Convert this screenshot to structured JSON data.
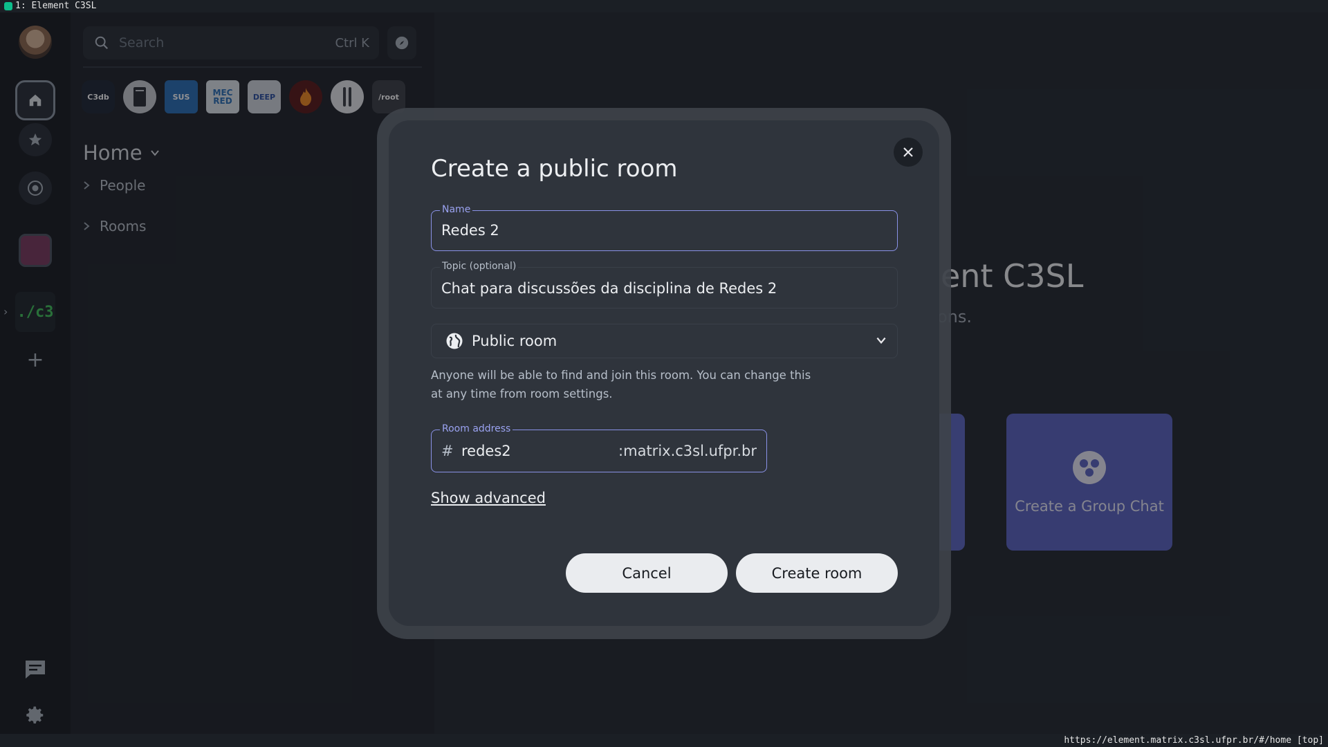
{
  "window": {
    "title": "1: Element C3SL"
  },
  "status_url": "https://element.matrix.c3sl.ufpr.br/#/home [top]",
  "search": {
    "placeholder": "Search",
    "shortcut": "Ctrl K"
  },
  "spaces_rail": {
    "c3_label": "./c3"
  },
  "space_row": [
    {
      "label": "C3db",
      "color": "#1f2937"
    },
    {
      "label": "",
      "color": "#c9ccd1"
    },
    {
      "label": "SUS",
      "color": "#2a6fb6"
    },
    {
      "label": "MEC RED",
      "color": "#dde3ea"
    },
    {
      "label": "DEEP",
      "color": "#cfd5dc"
    },
    {
      "label": "",
      "color": "#5a1a1a"
    },
    {
      "label": "",
      "color": "#e4e6e9"
    },
    {
      "label": "/root",
      "color": "#3c4048"
    }
  ],
  "home": {
    "title": "Home"
  },
  "sections": {
    "people": "People",
    "rooms": "Rooms"
  },
  "main": {
    "welcome_title": "ent C3SL",
    "welcome_sub": "ons.",
    "group_chat_label": "Create a Group Chat"
  },
  "dialog": {
    "title": "Create a public room",
    "name_label": "Name",
    "name_value": "Redes 2",
    "topic_label": "Topic (optional)",
    "topic_value": "Chat para discussões da disciplina de Redes 2",
    "visibility": "Public room",
    "hint": "Anyone will be able to find and join this room. You can change this at any time from room settings.",
    "address_label": "Room address",
    "address_prefix": "#",
    "address_local": "redes2",
    "address_server": ":matrix.c3sl.ufpr.br",
    "show_advanced": "Show advanced",
    "cancel": "Cancel",
    "create": "Create room"
  },
  "colors": {
    "accent": "#8a92e8",
    "group_card": "#5b64c2"
  }
}
